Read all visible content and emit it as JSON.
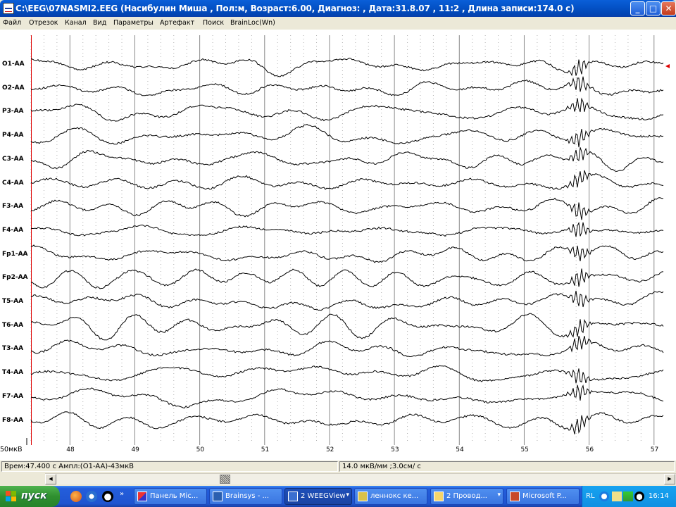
{
  "window": {
    "title": "C:\\EEG\\07NASMI2.EEG (Насибулин Миша , Пол:м, Возраст:6.00, Диагноз: , Дата:31.8.07 , 11:2 , Длина записи:174.0 с)",
    "buttons": {
      "minimize": "_",
      "maximize": "□",
      "close": "✕"
    }
  },
  "menu": [
    "Файл",
    "Отрезок",
    "Канал",
    "Вид",
    "Параметры",
    "Артефакт",
    "Поиск",
    "BrainLoc(Wn)"
  ],
  "channels": [
    "O1-AA",
    "O2-AA",
    "P3-AA",
    "P4-AA",
    "C3-AA",
    "C4-AA",
    "F3-AA",
    "F4-AA",
    "Fp1-AA",
    "Fp2-AA",
    "T5-AA",
    "T6-AA",
    "T3-AA",
    "T4-AA",
    "F7-AA",
    "F8-AA"
  ],
  "time_axis": {
    "ticks": [
      "48",
      "49",
      "50",
      "51",
      "52",
      "53",
      "54",
      "55",
      "56",
      "57"
    ],
    "start_seconds": 47.4,
    "end_seconds": 57.1
  },
  "scale_label": "50мкВ",
  "status": {
    "left": "Врем:47.400 с Ампл:(O1-AA)-43мкВ",
    "right": "14.0 мкВ/мм ;3.0см/ с"
  },
  "scrollbar": {
    "left_arrow": "◀",
    "right_arrow": "▶"
  },
  "taskbar": {
    "start_label": "пуск",
    "tasks": [
      {
        "label": "Панель Mic...",
        "active": false
      },
      {
        "label": "Brainsys - ...",
        "active": false
      },
      {
        "label": "2 WEEGView",
        "active": true
      },
      {
        "label": "леннокс ке...",
        "active": false
      },
      {
        "label": "2 Провод...",
        "active": false
      },
      {
        "label": "Microsoft P...",
        "active": false
      }
    ],
    "lang": "RL",
    "clock": "16:14"
  },
  "colors": {
    "titlebar": "#0a5fd8",
    "trace": "#000000",
    "grid_major": "#8a8a8a",
    "grid_minor": "#b0b0b0",
    "marker": "#dd0000",
    "taskbar": "#245edb",
    "start_button": "#2f8f2f"
  }
}
